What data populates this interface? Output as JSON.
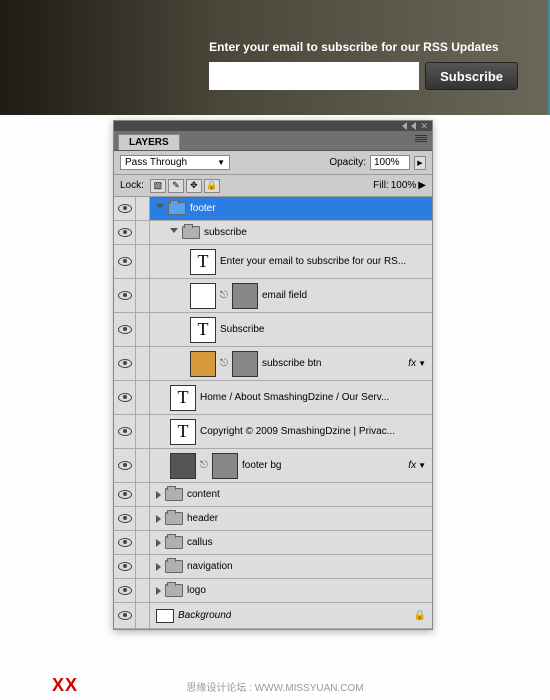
{
  "banner": {
    "label": "Enter your email to subscribe for our RSS Updates",
    "button": "Subscribe"
  },
  "panel": {
    "tab": "LAYERS",
    "blend_mode": "Pass Through",
    "opacity_label": "Opacity:",
    "opacity_value": "100%",
    "lock_label": "Lock:",
    "fill_label": "Fill:",
    "fill_value": "100%"
  },
  "layers": {
    "footer": "footer",
    "subscribe": "subscribe",
    "enter_email_text": "Enter your email to subscribe for our RS...",
    "email_field": "email field",
    "subscribe_text": "Subscribe",
    "subscribe_btn": "subscribe btn",
    "nav_text": "Home  /  About SmashingDzine  /  Our Serv...",
    "copyright_text": "Copyright © 2009 SmashingDzine  |  Privac...",
    "footer_bg": "footer bg",
    "content": "content",
    "header": "header",
    "callus": "callus",
    "navigation": "navigation",
    "logo": "logo",
    "background": "Background",
    "fx": "fx"
  },
  "watermark": "XX",
  "credit": "思缘设计论坛 : WWW.MISSYUAN.COM"
}
